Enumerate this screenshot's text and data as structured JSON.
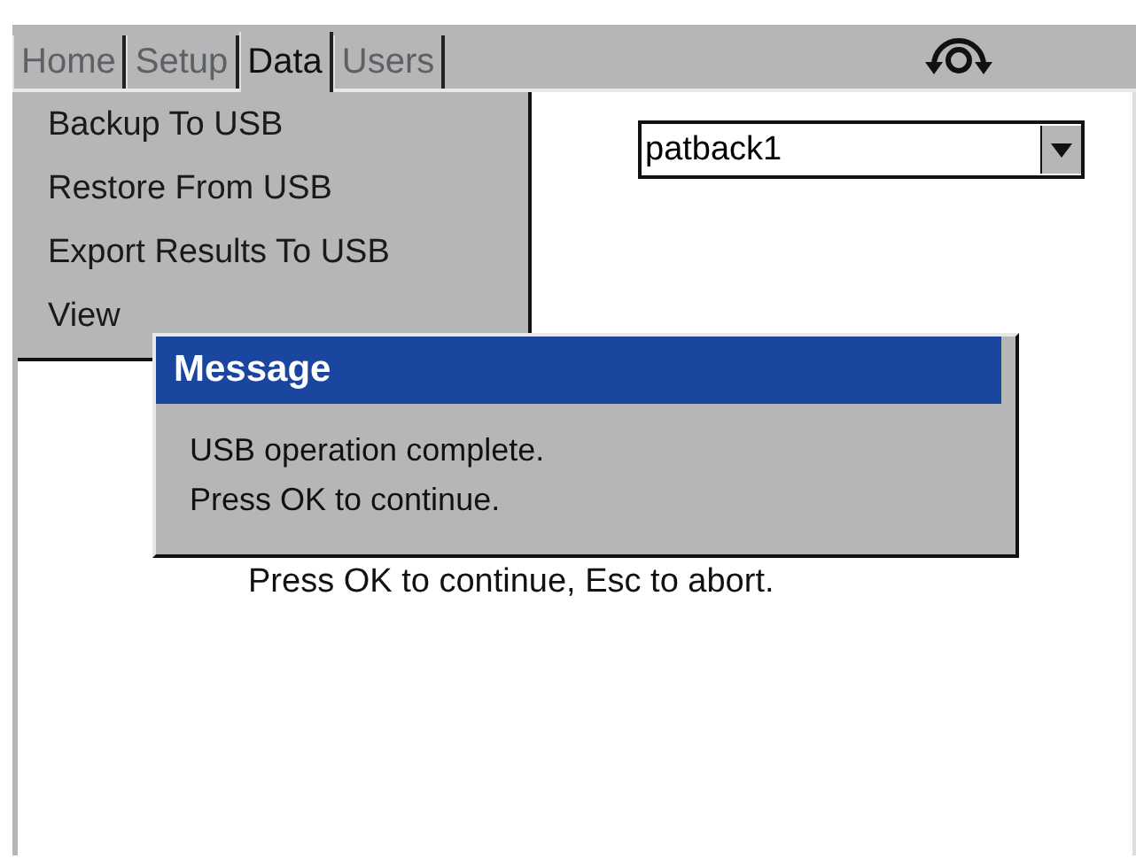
{
  "tabs": [
    {
      "label": "Home",
      "selected": false
    },
    {
      "label": "Setup",
      "selected": false
    },
    {
      "label": "Data",
      "selected": true
    },
    {
      "label": "Users",
      "selected": false
    }
  ],
  "menu": {
    "items": [
      "Backup To USB",
      "Restore From USB",
      "Export Results To USB",
      "View"
    ]
  },
  "dropdown": {
    "value": "patback1"
  },
  "hint": "Press OK to continue, Esc to abort.",
  "dialog": {
    "title": "Message",
    "lines": [
      "USB operation complete.",
      "Press OK to continue."
    ]
  }
}
